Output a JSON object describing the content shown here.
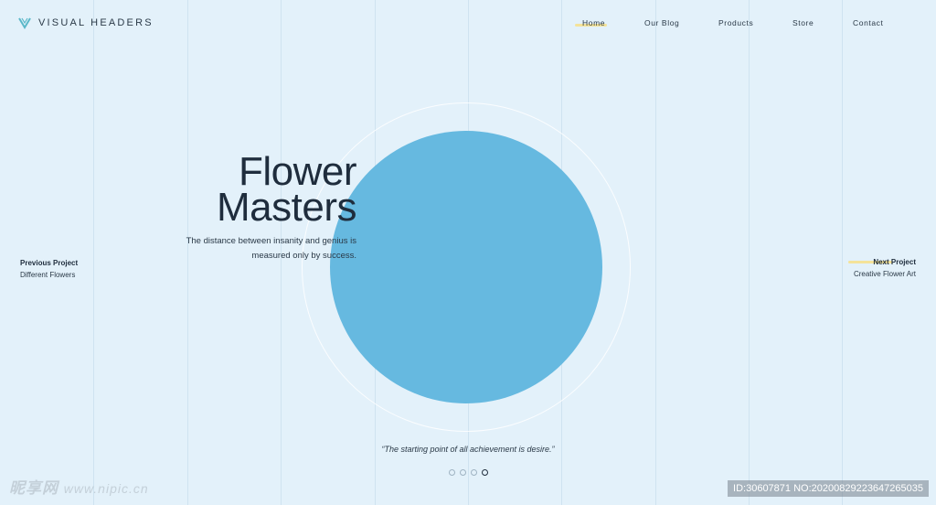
{
  "brand": {
    "name": "VISUAL HEADERS",
    "logo_icon": "v-logo-icon",
    "accent": "#5bb8c9"
  },
  "nav": {
    "items": [
      {
        "label": "Home",
        "active": true
      },
      {
        "label": "Our Blog"
      },
      {
        "label": "Products"
      },
      {
        "label": "Store"
      },
      {
        "label": "Contact"
      }
    ]
  },
  "hero": {
    "title_line1": "Flower",
    "title_line2": "Masters",
    "subtitle": "The distance between insanity and genius is measured only by success.",
    "circle_color": "#66b9e0"
  },
  "previous": {
    "label": "Previous Project",
    "name": "Different Flowers"
  },
  "next": {
    "label": "Next Project",
    "name": "Creative Flower Art"
  },
  "quote": "“The starting point of all achievement is desire.”",
  "pagination": {
    "count": 4,
    "active": 4
  },
  "watermark": {
    "left": "昵享网",
    "left_url": "www.nipic.cn",
    "right": "ID:30607871 NO:20200829223647265035"
  },
  "colors": {
    "background": "#e3f1fa",
    "highlight": "#f4e39a",
    "text": "#1f2d3d"
  }
}
